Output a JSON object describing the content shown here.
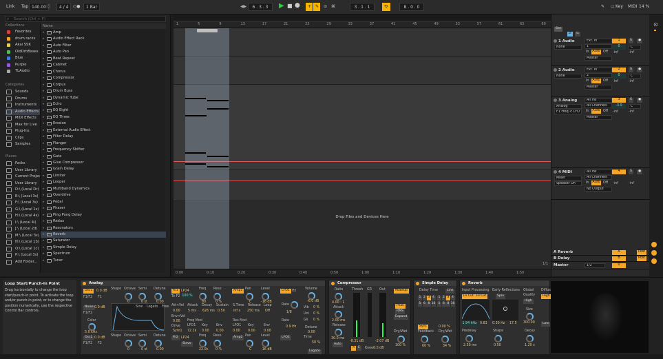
{
  "topbar": {
    "link": "Link",
    "tap": "Tap",
    "tempo": "140.00",
    "signature": "4 / 4",
    "metro": "○●",
    "quantize": "1 Bar",
    "position": "6 . 3 . 3",
    "loop_start": "3 . 1 . 1",
    "loop_length": "8 . 0 . 0",
    "key": "Key",
    "midi": "MIDI",
    "cpu": "14 %",
    "colors": {
      "accent": "#f4b400",
      "play": "#2ecc40"
    }
  },
  "browser": {
    "search_placeholder": "Search (Ctrl + F)",
    "collections_header": "Collections",
    "collections": [
      {
        "label": "Favorites",
        "color": "#e0403a"
      },
      {
        "label": "drum racks",
        "color": "#f4a62a"
      },
      {
        "label": "Akai SSK",
        "color": "#e8d24a"
      },
      {
        "label": "OldDrbBases",
        "color": "#4ac05a"
      },
      {
        "label": "Blue",
        "color": "#3a7ee0"
      },
      {
        "label": "Purple",
        "color": "#9a5ae0"
      },
      {
        "label": "TLAudio",
        "color": "#aaaaaa"
      }
    ],
    "categories_header": "Categories",
    "categories": [
      "Sounds",
      "Drums",
      "Instruments",
      "Audio Effects",
      "MIDI Effects",
      "Max for Live",
      "Plug-Ins",
      "Clips",
      "Samples"
    ],
    "selected_category": "Audio Effects",
    "places_header": "Places",
    "places": [
      "Packs",
      "User Library",
      "Current Project",
      "User Library",
      "D:\\ (Local Dr)",
      "E:\\ (Local 3s)",
      "F:\\ (Local 3s)",
      "G:\\ (Local 1s)",
      "H:\\ (Local 4s)",
      "I:\\ (Local 4i)",
      "J:\\ (Local 2d)",
      "M:\\ (Local 3s)",
      "N:\\ (Local 1b)",
      "O:\\ (Local 1c)",
      "P:\\ (Local 3s)",
      "Add Folder..."
    ],
    "list_header": "Name",
    "items": [
      "Amp",
      "Audio Effect Rack",
      "Auto Filter",
      "Auto Pan",
      "Beat Repeat",
      "Cabinet",
      "Chorus",
      "Compressor",
      "Corpus",
      "Drum Buss",
      "Dynamic Tube",
      "Echo",
      "EQ Eight",
      "EQ Three",
      "Erosion",
      "External Audio Effect",
      "Filter Delay",
      "Flanger",
      "Frequency Shifter",
      "Gate",
      "Glue Compressor",
      "Grain Delay",
      "Limiter",
      "Looper",
      "Multiband Dynamics",
      "Overdrive",
      "Pedal",
      "Phaser",
      "Ping Pong Delay",
      "Redux",
      "Resonators",
      "Reverb",
      "Saturator",
      "Simple Delay",
      "Spectrum",
      "Tuner"
    ],
    "selected_item": "Reverb"
  },
  "arrangement": {
    "bar_ticks": [
      "1",
      "5",
      "9",
      "13",
      "17",
      "21",
      "25",
      "29",
      "33",
      "37",
      "41",
      "45",
      "49",
      "53",
      "57",
      "61",
      "65",
      "69"
    ],
    "time_ticks": [
      "0:00",
      "0:10",
      "0:20",
      "0:30",
      "0:40",
      "0:50",
      "1:00",
      "1:10",
      "1:20",
      "1:30",
      "1:40",
      "1:50"
    ],
    "drop_text": "Drop Files and Devices Here",
    "zoom": "1/1"
  },
  "mixer": {
    "set_label": "Set",
    "tracks": [
      {
        "name": "1 Audio",
        "input": "Ext. In",
        "sub_input": "1",
        "monitor": "None",
        "vol": "0",
        "pan": "C",
        "route": "Master",
        "num": "1"
      },
      {
        "name": "2 Audio",
        "input": "Ext. In",
        "sub_input": "2",
        "monitor": "None",
        "vol": "0",
        "pan": "C",
        "route": "Master",
        "num": "2"
      },
      {
        "name": "3 Analog",
        "input": "All Ins",
        "sub_input": "All Channels",
        "monitor": "Analog",
        "vol": "-3.0",
        "pan": "C",
        "route": "Master",
        "num": "3",
        "chain": "F1 Freq < LFO"
      },
      {
        "name": "4 MIDI",
        "input": "All Ins",
        "sub_input": "All Channels",
        "monitor": "Mixer",
        "vol": "",
        "pan": "",
        "route": "No Output",
        "num": "4",
        "chain": "Speaker On"
      }
    ],
    "returns": [
      {
        "name": "A Reverb",
        "letter": "A",
        "mode": "Post"
      },
      {
        "name": "B Delay",
        "letter": "B",
        "mode": "Post"
      }
    ],
    "master": {
      "name": "Master",
      "cue": "1/2",
      "vol": "0"
    },
    "in": "In",
    "auto": "Auto",
    "off": "Off",
    "inf": "-inf"
  },
  "help": {
    "title": "Loop Start/Punch-In Point",
    "body": "Drag horizontally to change the loop start/punch-in point. To activate the loop and/or punch-in point, or to change the position numerically, use the respective Control Bar controls."
  },
  "analog": {
    "title": "Analog",
    "osc1": "Osc1",
    "osc1_level": "0.0 dB",
    "osc1_wave": "F1/F2",
    "osc1_f1": "F1",
    "shape": "Shape",
    "octave": "Octave",
    "semi": "Semi",
    "detune": "Detune",
    "oct_val": "0",
    "semi_val": "0 st",
    "detune_val": "0.00",
    "fil1": "Fil1",
    "fil1_type": "LP24",
    "fil1_to": "To F2",
    "fil1_pct": "100 %",
    "freq": "Freq",
    "reso": "Reso",
    "freq_val": "80",
    "reso_val": "0 %",
    "amp1": "Amp1",
    "pan": "Pan",
    "level": "Level",
    "pan_val": "C",
    "level_val": "-16 dB",
    "lfo1": "LFO1",
    "hz": "Hz",
    "rate": "Rate",
    "rate_val": "1/8",
    "rate2_val": "0.9 Hz",
    "noise": "Noise",
    "noise_level": "0.0 dB",
    "noise_wave": "F1/F2",
    "color": "Color",
    "color_val": "5.0 kHz",
    "balance": "Balance",
    "fil1_env": "Fil1 Env",
    "sub_shape": "Sine",
    "sub_legato": "Legato",
    "sub_free": "Free",
    "att_vel": "Att<Vel",
    "attack": "Attack",
    "decay": "Decay",
    "sustain": "Sustain",
    "s_time": "S.Time",
    "release": "Release",
    "loop": "Loop",
    "att_vel_val": "0.00",
    "attack_val": "5 ms",
    "decay_val": "626 ms",
    "sustain_val": "0.50",
    "stime_val": "inf s",
    "release_val": "250 ms",
    "loop_val": "Off",
    "env_vel": "Env<Vel",
    "env_vel_val": "0.00",
    "drive": "Drive",
    "drive_val": "Sym1",
    "freq_mod": "Freq Mod",
    "lfo1_lbl": "LFO1",
    "key": "Key",
    "env": "Env",
    "res_mod": "Res Mod",
    "lfo_val": "72.1k",
    "key_val": "0.00",
    "env_val": "0.00",
    "res_lfo": "0.00",
    "res_key": "0.00",
    "res_env": "0.00",
    "osc2": "Osc2",
    "osc2_level": "0.0 dB",
    "osc2_wave": "F1/F2",
    "osc2_f2": "F2",
    "fil2": "Fil2",
    "fil2_type": "LP24",
    "fil2_slave": "Slave",
    "freq2_val": "22.0k",
    "reso2_val": "0 %",
    "amp2": "Amp2",
    "level2_val": "-16 dB",
    "lfo2": "LFO2",
    "retrig": "Retrig",
    "width": "Width",
    "volume": "Volume",
    "volume_val": "-6.0 dB",
    "vib": "Vib",
    "vib_val": "0 %",
    "uni": "Uni",
    "uni_val": "0 %",
    "gli": "Gli",
    "gli_val": "0 %",
    "voices_lbl": "Voices",
    "voices": "6",
    "detune2": "Detune",
    "detune2_val": "0.00",
    "time": "Time",
    "time_val": "50 %",
    "legato": "Legato",
    "rate3": "Rate",
    "rate3_val": "0.1 Hz"
  },
  "compressor": {
    "title": "Compressor",
    "ratio": "Ratio",
    "ratio_val": "4.00 : 1",
    "attack": "Attack",
    "attack_val": "2.00 ms",
    "release": "Release",
    "release_val": "30.0 ms",
    "auto": "Auto",
    "thresh": "Thresh",
    "gr": "GR",
    "out": "Out",
    "thresh_val": "-8.31 dB",
    "out_val": "-2.07 dB",
    "makeup": "Makeup",
    "peak": "Peak",
    "rms": "RMS",
    "expand": "Expand",
    "knee": "Knee",
    "knee_val": "6.0 dB",
    "drywet": "Dry/Wet",
    "drywet_val": "100 %",
    "mode_a": "A",
    "mode_b": "E"
  },
  "simple_delay": {
    "title": "Simple Delay",
    "delay_time": "Delay Time",
    "link": "Link",
    "grid_l": [
      "1",
      "2",
      "3",
      "4",
      "5",
      "6",
      "8",
      "16"
    ],
    "grid_r": [
      "1",
      "2",
      "3",
      "4",
      "5",
      "6",
      "8",
      "16"
    ],
    "sync": "Sync",
    "sync_val": "0.00 %",
    "feedback": "Feedback",
    "feedback_val": "60 %",
    "drywet": "Dry/Wet",
    "drywet_val": "34 %"
  },
  "reverb": {
    "title": "Reverb",
    "input_proc": "Input Processing",
    "lo_cut": "Lo Cut",
    "hi_cut": "Hi Cut",
    "freq_val": "1.94 kHz",
    "width_val": "0.81",
    "early": "Early Reflections",
    "spin": "Spin",
    "spin_a": "0.30 Hz",
    "spin_b": "17.5",
    "global": "Global",
    "quality": "Quality",
    "quality_val": "High",
    "size": "Size",
    "size_val": "300.00",
    "diffuse": "Diffus",
    "low": "Low",
    "predelay": "Predelay",
    "predelay_val": "2.50 ms",
    "shape": "Shape",
    "shape_val": "0.50",
    "decay": "Decay",
    "decay_val": "1.20 s",
    "stereo": "Stereo",
    "stereo_val": "120.00",
    "dens": "Dens",
    "dens_val": "5.9"
  }
}
